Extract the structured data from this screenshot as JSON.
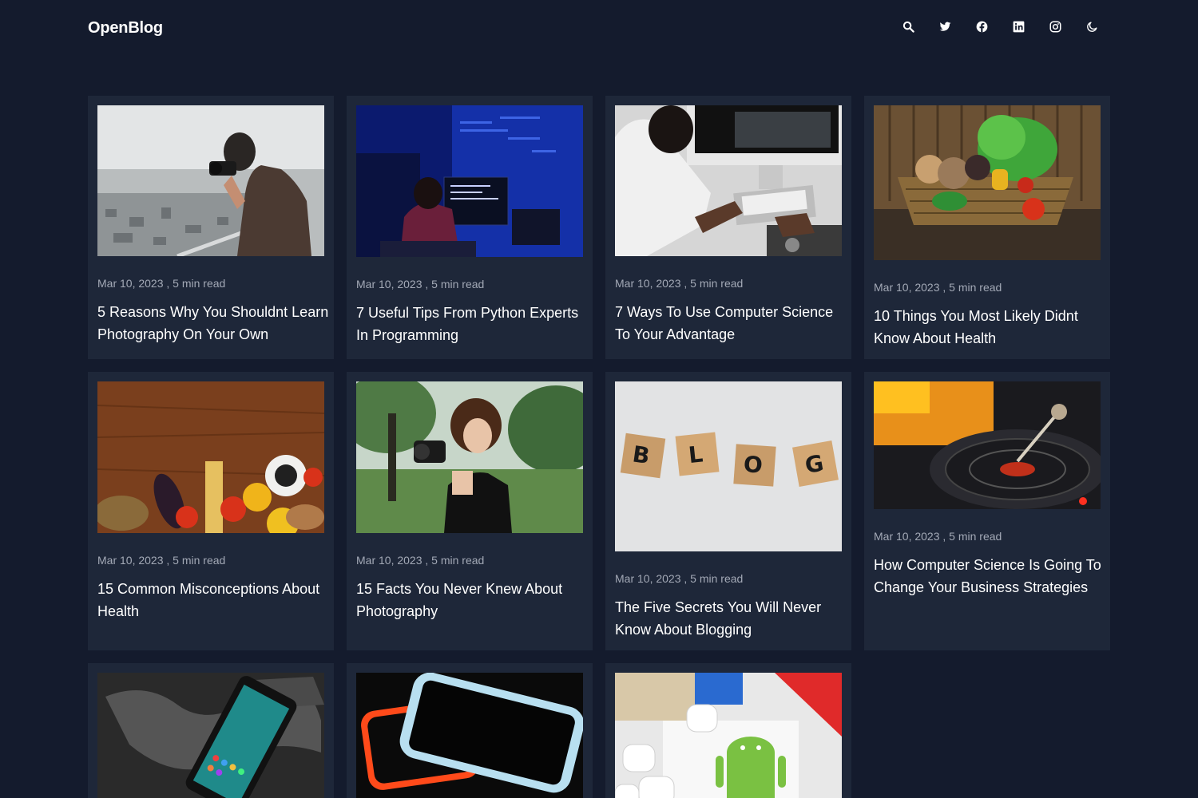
{
  "header": {
    "logo": "OpenBlog",
    "icons": [
      "search-icon",
      "twitter-icon",
      "facebook-icon",
      "linkedin-icon",
      "instagram-icon",
      "moon-icon"
    ]
  },
  "posts": [
    {
      "date": "Mar 10, 2023",
      "read_time": "5 min read",
      "meta": "Mar 10, 2023 , 5 min read",
      "title": "5 Reasons Why You Shouldnt Learn Photography On Your Own",
      "image": "photographer-on-balcony"
    },
    {
      "date": "Mar 10, 2023",
      "read_time": "5 min read",
      "meta": "Mar 10, 2023 , 5 min read",
      "title": "7 Useful Tips From Python Experts In Programming",
      "image": "programmer-blue-room"
    },
    {
      "date": "Mar 10, 2023",
      "read_time": "5 min read",
      "meta": "Mar 10, 2023 , 5 min read",
      "title": "7 Ways To Use Computer Science To Your Advantage",
      "image": "person-at-imac"
    },
    {
      "date": "Mar 10, 2023",
      "read_time": "5 min read",
      "meta": "Mar 10, 2023 , 5 min read",
      "title": "10 Things You Most Likely Didnt Know About Health",
      "image": "vegetable-basket"
    },
    {
      "date": "Mar 10, 2023",
      "read_time": "5 min read",
      "meta": "Mar 10, 2023 , 5 min read",
      "title": "15 Common Misconceptions About Health",
      "image": "food-on-wood-table"
    },
    {
      "date": "Mar 10, 2023",
      "read_time": "5 min read",
      "meta": "Mar 10, 2023 , 5 min read",
      "title": "15 Facts You Never Knew About Photography",
      "image": "woman-with-camera"
    },
    {
      "date": "Mar 10, 2023",
      "read_time": "5 min read",
      "meta": "Mar 10, 2023 , 5 min read",
      "title": "The Five Secrets You Will Never Know About Blogging",
      "image": "blog-letter-tiles"
    },
    {
      "date": "Mar 10, 2023",
      "read_time": "5 min read",
      "meta": "Mar 10, 2023 , 5 min read",
      "title": "How Computer Science Is Going To Change Your Business Strategies",
      "image": "turntable"
    },
    {
      "image": "phone-on-map"
    },
    {
      "image": "smartphones"
    },
    {
      "image": "android-figure"
    }
  ],
  "colors": {
    "background": "#141b2d",
    "card": "#1e2739",
    "meta_text": "#a3a9b6",
    "title_text": "#ffffff"
  }
}
